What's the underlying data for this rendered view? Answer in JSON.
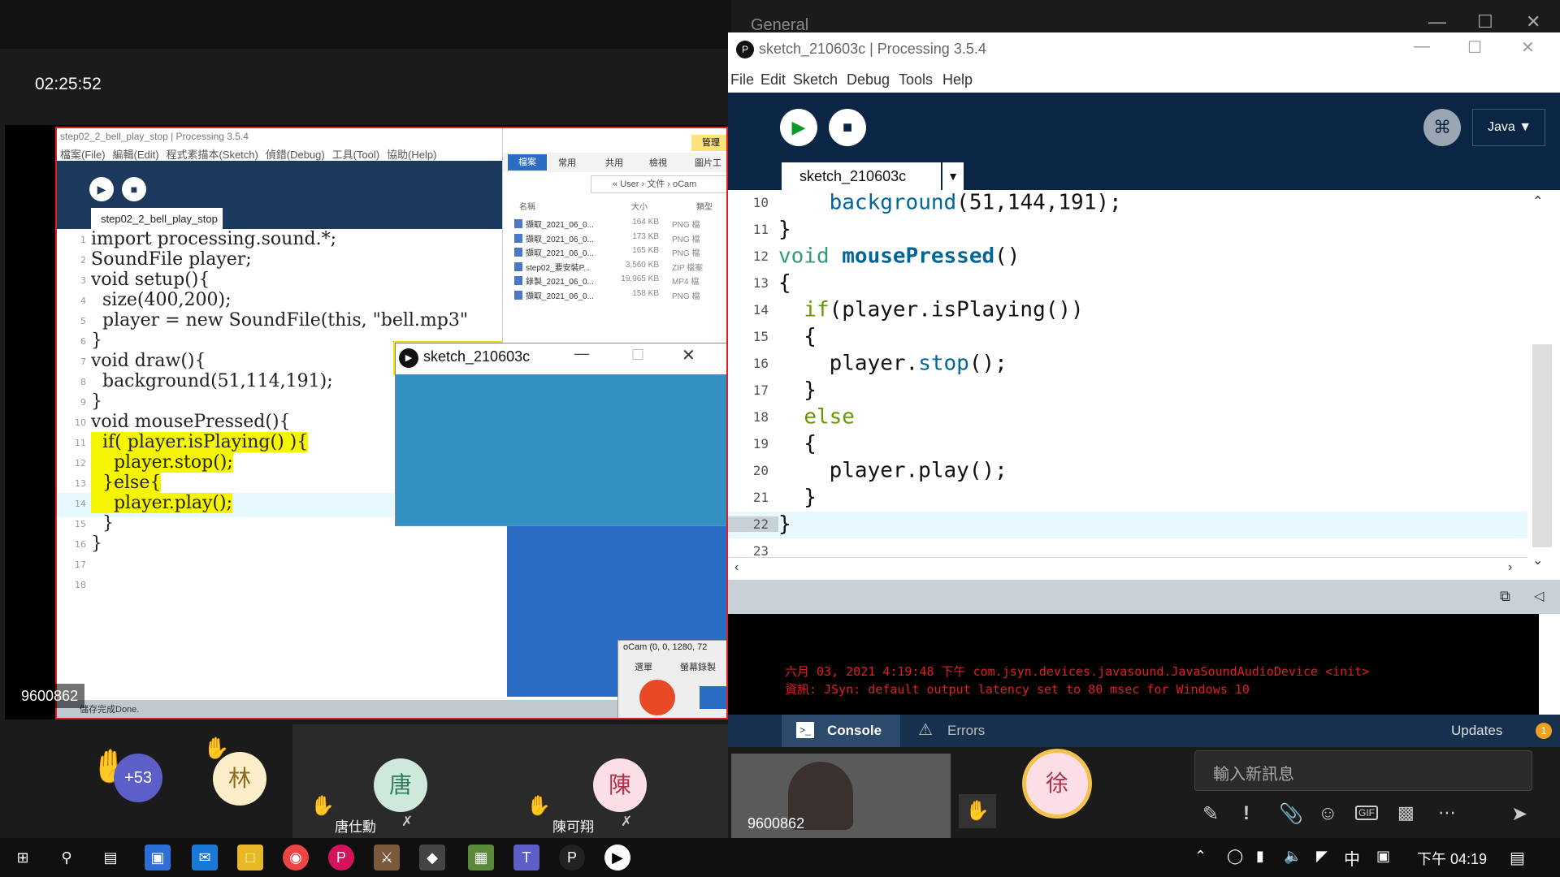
{
  "meeting": {
    "timer": "02:25:52",
    "channel": "General",
    "shared_user_id": "9600862",
    "self_video_id": "9600862"
  },
  "shared_ide": {
    "title": "step02_2_bell_play_stop | Processing 3.5.4",
    "menu": [
      "檔案(File)",
      "編輯(Edit)",
      "程式素描本(Sketch)",
      "偵錯(Debug)",
      "工具(Tool)",
      "協助(Help)"
    ],
    "tab": "step02_2_bell_play_stop",
    "status": "儲存完成Done.",
    "lines": [
      {
        "n": "1",
        "t": "import processing.sound.*;"
      },
      {
        "n": "2",
        "t": "SoundFile player;"
      },
      {
        "n": "3",
        "t": "void setup(){"
      },
      {
        "n": "4",
        "t": "  size(400,200);"
      },
      {
        "n": "5",
        "t": "  player = new SoundFile(this, \"bell.mp3\""
      },
      {
        "n": "6",
        "t": "}"
      },
      {
        "n": "7",
        "t": "void draw(){"
      },
      {
        "n": "8",
        "t": "  background(51,114,191);"
      },
      {
        "n": "9",
        "t": "}"
      },
      {
        "n": "10",
        "t": "void mousePressed(){"
      },
      {
        "n": "11",
        "t": "  if( player.isPlaying() ){"
      },
      {
        "n": "12",
        "t": "    player.stop();"
      },
      {
        "n": "13",
        "t": "  }else{"
      },
      {
        "n": "14",
        "t": "    player.play();"
      },
      {
        "n": "15",
        "t": "  }"
      },
      {
        "n": "16",
        "t": "}"
      },
      {
        "n": "17",
        "t": ""
      },
      {
        "n": "18",
        "t": ""
      }
    ]
  },
  "explorer": {
    "ribbon_tabs": [
      "檔案",
      "常用",
      "共用",
      "檢視"
    ],
    "ribbon_right": [
      "管理",
      "圖片工"
    ],
    "path": [
      "User",
      "文件",
      "oCam"
    ],
    "headers": [
      "名稱",
      "大小",
      "類型"
    ],
    "files": [
      {
        "name": "擷取_2021_06_0...",
        "size": "164 KB",
        "type": "PNG 檔"
      },
      {
        "name": "擷取_2021_06_0...",
        "size": "173 KB",
        "type": "PNG 檔"
      },
      {
        "name": "擷取_2021_06_0...",
        "size": "165 KB",
        "type": "PNG 檔"
      },
      {
        "name": "step02_要安裝P...",
        "size": "3,560 KB",
        "type": "ZIP 檔案"
      },
      {
        "name": "錄製_2021_06_0...",
        "size": "19,965 KB",
        "type": "MP4 檔"
      },
      {
        "name": "擷取_2021_06_0...",
        "size": "158 KB",
        "type": "PNG 檔"
      }
    ]
  },
  "sketch_window": {
    "title": "sketch_210603c",
    "color": "#3390c3"
  },
  "ocam": {
    "title": "oCam (0, 0, 1280, 72",
    "menu": [
      "選單",
      "螢幕錄製"
    ]
  },
  "ide": {
    "title": "sketch_210603c | Processing 3.5.4",
    "menu": [
      "File",
      "Edit",
      "Sketch",
      "Debug",
      "Tools",
      "Help"
    ],
    "mode": "Java",
    "tab": "sketch_210603c",
    "lines": [
      {
        "n": "10",
        "parts": [
          [
            "    ",
            ""
          ],
          [
            "background",
            "c-fn"
          ],
          [
            "(51,144,191);",
            ""
          ]
        ]
      },
      {
        "n": "11",
        "parts": [
          [
            "}",
            ""
          ]
        ]
      },
      {
        "n": "12",
        "parts": [
          [
            "void ",
            "c-kw"
          ],
          [
            "mousePressed",
            "c-fn bold"
          ],
          [
            "()",
            ""
          ]
        ]
      },
      {
        "n": "13",
        "parts": [
          [
            "{",
            ""
          ]
        ]
      },
      {
        "n": "14",
        "parts": [
          [
            "  ",
            ""
          ],
          [
            "if",
            "c-kw2"
          ],
          [
            "(player.isPlaying())",
            ""
          ]
        ]
      },
      {
        "n": "15",
        "parts": [
          [
            "  {",
            ""
          ]
        ]
      },
      {
        "n": "16",
        "parts": [
          [
            "    player.",
            ""
          ],
          [
            "stop",
            "c-fn"
          ],
          [
            "();",
            ""
          ]
        ]
      },
      {
        "n": "17",
        "parts": [
          [
            "  }",
            ""
          ]
        ]
      },
      {
        "n": "18",
        "parts": [
          [
            "  ",
            ""
          ],
          [
            "else",
            "c-kw2"
          ]
        ]
      },
      {
        "n": "19",
        "parts": [
          [
            "  {",
            ""
          ]
        ]
      },
      {
        "n": "20",
        "parts": [
          [
            "    player.play();",
            ""
          ]
        ]
      },
      {
        "n": "21",
        "parts": [
          [
            "  }",
            ""
          ]
        ]
      },
      {
        "n": "22",
        "parts": [
          [
            "}",
            ""
          ]
        ]
      },
      {
        "n": "23",
        "parts": [
          [
            "",
            ""
          ]
        ]
      }
    ],
    "console": [
      "六月 03, 2021 4:19:48 下午 com.jsyn.devices.javasound.JavaSoundAudioDevice <init>",
      "資訊: JSyn: default output latency set to 80 msec for Windows 10"
    ],
    "console_tab": "Console",
    "errors_tab": "Errors",
    "updates_label": "Updates",
    "updates_count": "1"
  },
  "participants": {
    "more_count": "+53",
    "people": [
      {
        "initial": "林",
        "name": ""
      },
      {
        "initial": "唐",
        "name": "唐仕勳"
      },
      {
        "initial": "陳",
        "name": "陳可翔"
      },
      {
        "initial": "徐",
        "name": ""
      }
    ]
  },
  "chat": {
    "placeholder": "輸入新訊息"
  },
  "taskbar": {
    "time": "下午 04:19",
    "ime": "中"
  }
}
